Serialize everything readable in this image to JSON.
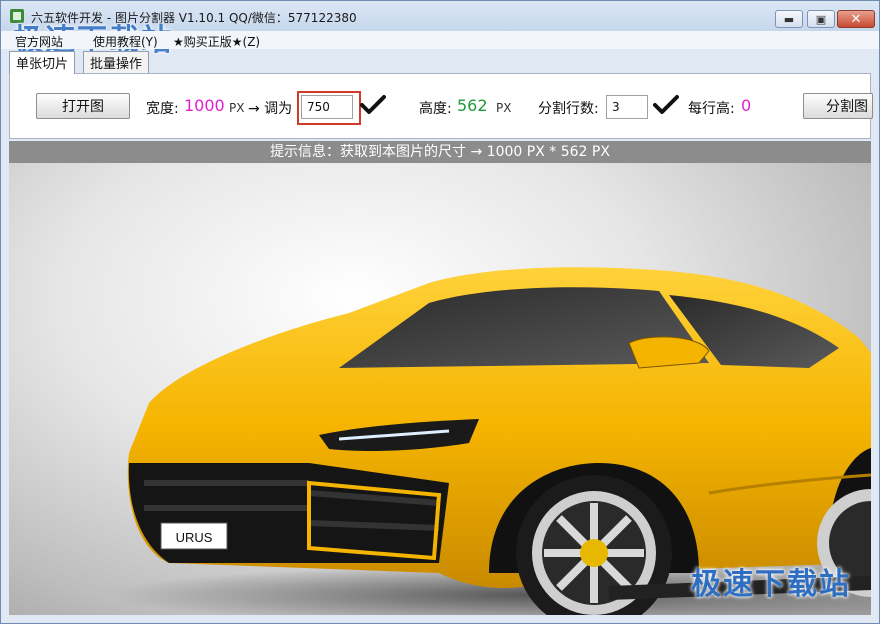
{
  "titlebar": {
    "title": "六五软件开发 - 图片分割器 V1.10.1    QQ/微信：577122380",
    "watermark": "极速下载站",
    "min_glyph": "▬",
    "max_glyph": "▣",
    "close_glyph": "✕"
  },
  "menu": {
    "items": [
      "官方网站",
      "使用教程(Y)",
      "★购买正版★(Z)"
    ]
  },
  "tabs": [
    {
      "label": "单张切片",
      "active": true
    },
    {
      "label": "批量操作",
      "active": false
    }
  ],
  "toolbar": {
    "open_button": "打开图",
    "width_label": "宽度:",
    "width_value": "1000",
    "width_unit": "PX",
    "arrow_label": "→ 调为",
    "resize_value": "750",
    "height_label": "高度:",
    "height_value": "562",
    "height_unit": "PX",
    "split_rows_label": "分割行数:",
    "split_rows_value": "3",
    "row_height_label": "每行高:",
    "row_height_value": "0",
    "split_button": "分割图",
    "colors": {
      "width_value": "#e020d0",
      "height_value": "#1f9a3a",
      "row_height_value": "#e020d0",
      "highlight_border": "#d23a2a"
    }
  },
  "info": {
    "text": "提示信息：获取到本图片的尺寸 → 1000 PX * 562 PX"
  },
  "preview": {
    "plate_text": "URUS",
    "watermark": "极速下载站"
  }
}
